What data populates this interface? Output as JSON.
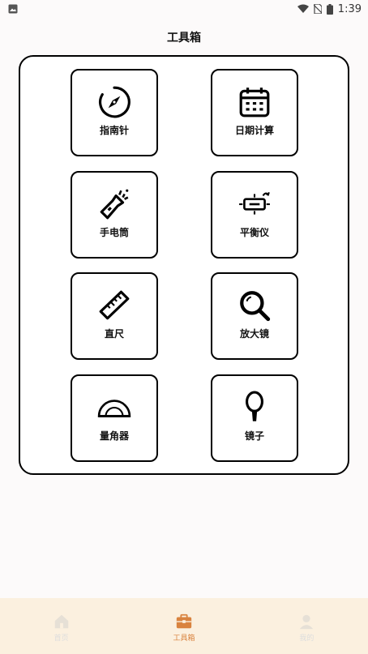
{
  "status": {
    "time": "1:39"
  },
  "header": {
    "title": "工具箱"
  },
  "tools": [
    {
      "label": "指南针",
      "icon": "compass-icon"
    },
    {
      "label": "日期计算",
      "icon": "calendar-icon"
    },
    {
      "label": "手电筒",
      "icon": "flashlight-icon"
    },
    {
      "label": "平衡仪",
      "icon": "level-icon"
    },
    {
      "label": "直尺",
      "icon": "ruler-icon"
    },
    {
      "label": "放大镜",
      "icon": "magnifier-icon"
    },
    {
      "label": "量角器",
      "icon": "protractor-icon"
    },
    {
      "label": "镜子",
      "icon": "mirror-icon"
    }
  ],
  "nav": {
    "items": [
      {
        "label": "首页",
        "icon": "home-icon"
      },
      {
        "label": "工具箱",
        "icon": "toolbox-icon"
      },
      {
        "label": "我的",
        "icon": "user-icon"
      }
    ],
    "active_color": "#d9833f",
    "inactive_color": "#dddddd"
  }
}
